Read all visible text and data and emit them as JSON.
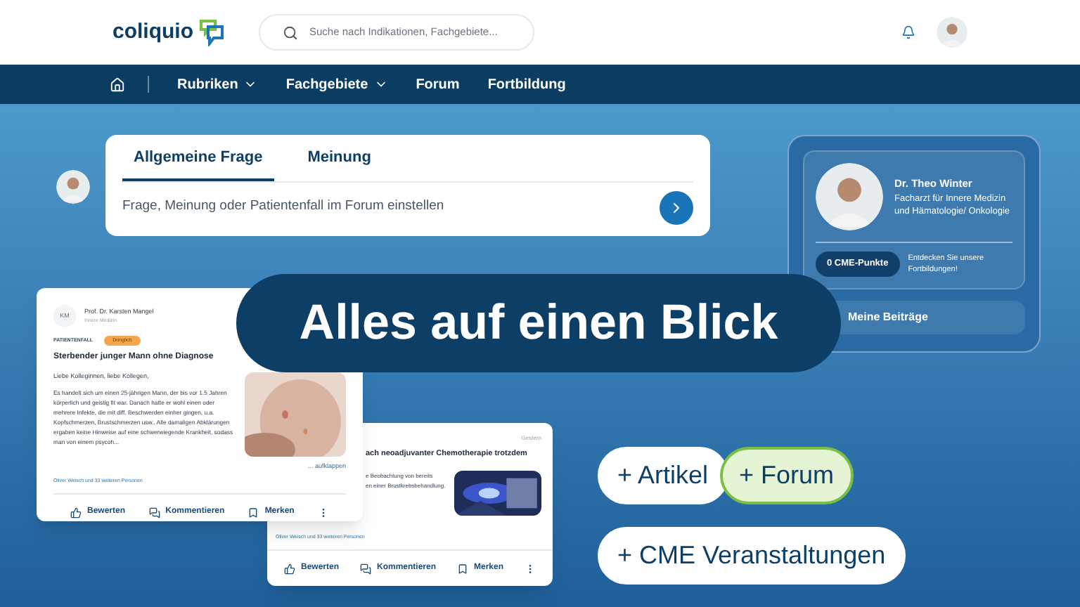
{
  "header": {
    "logo": "coliquio",
    "search": {
      "placeholder": "Suche nach Indikationen, Fachgebiete..."
    }
  },
  "nav": {
    "items": [
      {
        "label": "Rubriken",
        "dropdown": true
      },
      {
        "label": "Fachgebiete",
        "dropdown": true
      },
      {
        "label": "Forum",
        "dropdown": false
      },
      {
        "label": "Fortbildung",
        "dropdown": false
      }
    ]
  },
  "question": {
    "tabs": [
      {
        "label": "Allgemeine Frage",
        "selected": true
      },
      {
        "label": "Meinung",
        "selected": false
      }
    ],
    "placeholder": "Frage, Meinung oder Patientenfall im Forum einstellen"
  },
  "profile": {
    "name": "Dr. Theo Winter",
    "specialty": "Facharzt für Innere Medizin und Hämatologie/ Onkologie",
    "points": "0 CME-Punkte",
    "points_hint": "Entdecken Sie unsere Fortbildungen!",
    "link": "Meine Beiträge"
  },
  "headline": "Alles auf einen Blick",
  "post": {
    "initials": "KM",
    "author": "Prof. Dr. Karsten Mangel",
    "field": "Innere Medizin",
    "category": "PATIENTENFALL",
    "badge": "Dringlich",
    "title": "Sterbender junger Mann ohne Diagnose",
    "greeting": "Liebe Kolleginnen, liebe Kollegen,",
    "body": "Es handelt sich um einen 25-jährigen Mann, der bis vor 1.5 Jahren körperlich und geistig fit war. Danach hatte er wohl einen oder mehrere Infekte, die mit diff. Beschwerden einher gingen, u.a. Kopfschmerzen, Brustschmerzen usw.. Alle damaligen Abklärungen ergaben keine Hinweise auf eine schwerwiegende Krankheit, sodass man von einem psycoh...",
    "expand": "... aufklappen",
    "reactions": "Oliver Weisch und 33 weiteren Personen",
    "actions": [
      "Bewerten",
      "Kommentieren",
      "Merken"
    ]
  },
  "post2": {
    "date": "Gestern",
    "title": "ach neoadjuvanter Chemotherapie trotzdem",
    "body": [
      "e Beobachtung von bereits",
      "en einer Brustkrebsbehandlung."
    ],
    "reactions": "Oliver Weisch und 33 weiteren Personen",
    "actions": [
      "Bewerten",
      "Kommentieren",
      "Merken"
    ]
  },
  "pills": [
    {
      "label": "+ Artikel",
      "kind": "plain"
    },
    {
      "label": "+ Forum",
      "kind": "highlight"
    },
    {
      "label": "+ CME Veranstaltungen",
      "kind": "plain"
    }
  ]
}
